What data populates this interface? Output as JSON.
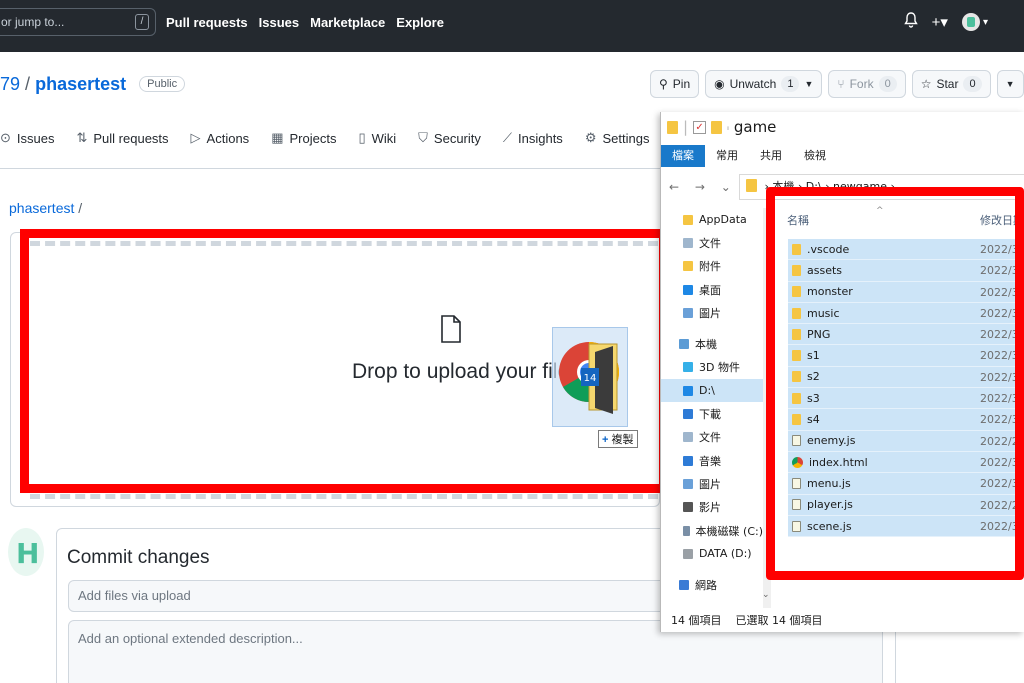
{
  "header": {
    "search_placeholder": "or jump to...",
    "search_shortcut": "/",
    "nav": [
      "Pull requests",
      "Issues",
      "Marketplace",
      "Explore"
    ],
    "bell_icon": "bell-icon",
    "plus_label": "+▾",
    "avatar_caret": "▾"
  },
  "repo": {
    "owner": "79",
    "separator": "/",
    "name": "phasertest",
    "visibility": "Public",
    "pin_label": "Pin",
    "unwatch_label": "Unwatch",
    "unwatch_count": "1",
    "fork_label": "Fork",
    "fork_count": "0",
    "star_label": "Star",
    "star_count": "0"
  },
  "tabs": [
    {
      "icon": "⊙",
      "label": "Issues"
    },
    {
      "icon": "⇅",
      "label": "Pull requests"
    },
    {
      "icon": "▷",
      "label": "Actions"
    },
    {
      "icon": "▦",
      "label": "Projects"
    },
    {
      "icon": "▯",
      "label": "Wiki"
    },
    {
      "icon": "⛉",
      "label": "Security"
    },
    {
      "icon": "⟋",
      "label": "Insights"
    },
    {
      "icon": "⚙",
      "label": "Settings"
    }
  ],
  "breadcrumb": {
    "repo": "phasertest",
    "sep": "/"
  },
  "dropzone": {
    "text": "Drop to upload your files",
    "drag_count": "14",
    "copy_label": "複製",
    "copy_plus": "+"
  },
  "commit": {
    "title": "Commit changes",
    "summary_placeholder": "Add files via upload",
    "description_placeholder": "Add an optional extended description..."
  },
  "explorer": {
    "title": "game",
    "title_prefix": "ᵢ",
    "ribbon": [
      "檔案",
      "常用",
      "共用",
      "檢視"
    ],
    "nav_buttons": "← → ⌄ ↑",
    "address": "› 本機 › D:\\ › newgame ›",
    "nav_items": [
      {
        "label": "AppData",
        "color": "#f5c542",
        "group": "quick"
      },
      {
        "label": "文件",
        "color": "#9fb6cd",
        "group": "quick"
      },
      {
        "label": "附件",
        "color": "#f5c542",
        "group": "quick"
      },
      {
        "label": "桌面",
        "color": "#1e88e5",
        "group": "quick"
      },
      {
        "label": "圖片",
        "color": "#6aa0d8",
        "group": "quick"
      },
      {
        "label": "本機",
        "color": "#5b9bd5",
        "group": "pc"
      },
      {
        "label": "3D 物件",
        "color": "#35b0e8",
        "group": "pc"
      },
      {
        "label": "D:\\",
        "color": "#1e88e5",
        "group": "pc",
        "selected": true
      },
      {
        "label": "下載",
        "color": "#2e7bd6",
        "group": "pc"
      },
      {
        "label": "文件",
        "color": "#9fb6cd",
        "group": "pc"
      },
      {
        "label": "音樂",
        "color": "#2e7bd6",
        "group": "pc"
      },
      {
        "label": "圖片",
        "color": "#6aa0d8",
        "group": "pc"
      },
      {
        "label": "影片",
        "color": "#555555",
        "group": "pc"
      },
      {
        "label": "本機磁碟 (C:)",
        "color": "#7a8fa6",
        "group": "pc"
      },
      {
        "label": "DATA (D:)",
        "color": "#9aa0a6",
        "group": "pc"
      },
      {
        "label": "網路",
        "color": "#3a7bd5",
        "group": "net"
      }
    ],
    "columns": {
      "name": "名稱",
      "date": "修改日期"
    },
    "files": [
      {
        "name": ".vscode",
        "type": "folder",
        "date": "2022/3/"
      },
      {
        "name": "assets",
        "type": "folder",
        "date": "2022/3/"
      },
      {
        "name": "monster",
        "type": "folder",
        "date": "2022/3/"
      },
      {
        "name": "music",
        "type": "folder",
        "date": "2022/3/"
      },
      {
        "name": "PNG",
        "type": "folder",
        "date": "2022/3/"
      },
      {
        "name": "s1",
        "type": "folder",
        "date": "2022/3/"
      },
      {
        "name": "s2",
        "type": "folder",
        "date": "2022/3/"
      },
      {
        "name": "s3",
        "type": "folder",
        "date": "2022/3/"
      },
      {
        "name": "s4",
        "type": "folder",
        "date": "2022/3/"
      },
      {
        "name": "enemy.js",
        "type": "js",
        "date": "2022/2/"
      },
      {
        "name": "index.html",
        "type": "html",
        "date": "2022/3/"
      },
      {
        "name": "menu.js",
        "type": "js",
        "date": "2022/3/"
      },
      {
        "name": "player.js",
        "type": "js",
        "date": "2022/2/"
      },
      {
        "name": "scene.js",
        "type": "js",
        "date": "2022/3/"
      }
    ],
    "status_count": "14 個項目",
    "status_selected": "已選取 14 個項目"
  },
  "colors": {
    "header_bg": "#24292f",
    "link": "#0969da",
    "highlight_red": "#ff0000",
    "selection": "#cce4f7",
    "ribbon_active": "#1979ca"
  }
}
